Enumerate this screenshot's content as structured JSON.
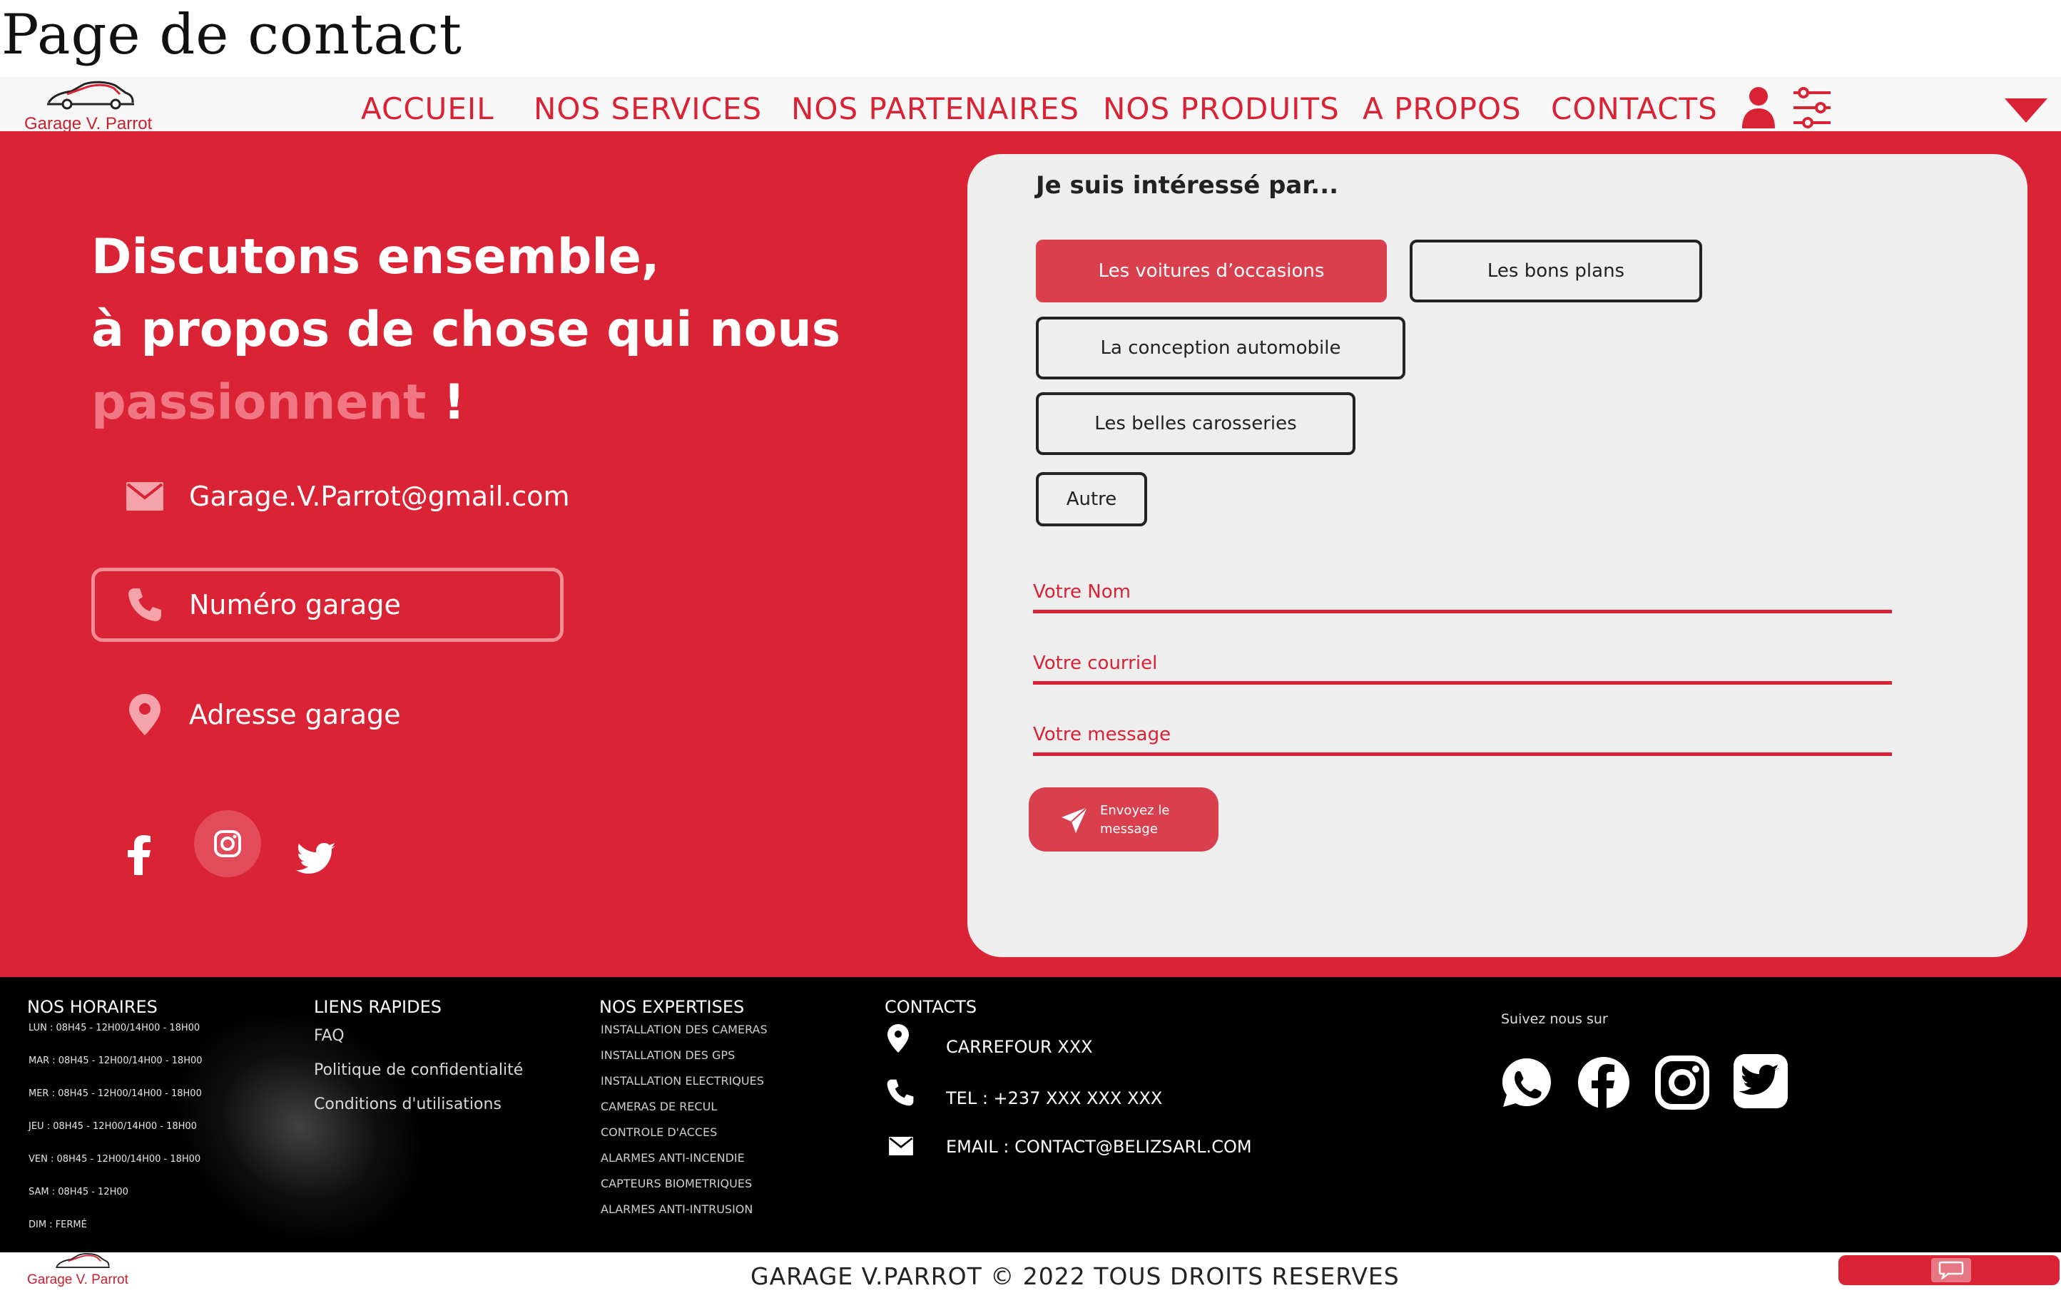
{
  "page_title": "Page de contact",
  "brand": {
    "name": "Garage V. Parrot",
    "accent": "#da2334"
  },
  "nav": {
    "items": [
      "ACCUEIL",
      "NOS SERVICES",
      "NOS PARTENAIRES",
      "NOS PRODUITS",
      "A PROPOS",
      "CONTACTS"
    ],
    "icons": [
      "user-icon",
      "settings-sliders-icon",
      "dropdown-triangle-icon"
    ]
  },
  "hero": {
    "line1": "Discutons ensemble,",
    "line2": "à propos de chose qui nous",
    "line3_accent": "passionnent",
    "line3_end": " !",
    "email": "Garage.V.Parrot@gmail.com",
    "phone": "Numéro garage",
    "address": "Adresse garage",
    "socials": [
      "facebook-icon",
      "instagram-icon",
      "twitter-icon"
    ]
  },
  "form": {
    "title": "Je suis intéressé par...",
    "chips": [
      "Les voitures d’occasions",
      "Les bons plans",
      "La conception automobile",
      "Les belles carosseries",
      "Autre"
    ],
    "active_chip": "Les voitures d’occasions",
    "name_label": "Votre Nom",
    "email_label": "Votre courriel",
    "message_label": "Votre message",
    "send_line1": "Envoyez le",
    "send_line2": "message"
  },
  "footer": {
    "hours_title": "NOS HORAIRES",
    "hours": [
      "LUN  : 08H45 - 12H00/14H00 - 18H00",
      "MAR : 08H45 - 12H00/14H00 - 18H00",
      "MER : 08H45 - 12H00/14H00 - 18H00",
      "JEU  : 08H45 - 12H00/14H00 - 18H00",
      "VEN  : 08H45 - 12H00/14H00 - 18H00",
      "SAM : 08H45 - 12H00",
      "DIM  : FERMÉ"
    ],
    "links_title": "LIENS RAPIDES",
    "links": [
      "FAQ",
      "Politique de confidentialité",
      "Conditions d'utilisations"
    ],
    "expertise_title": "NOS EXPERTISES",
    "expertises": [
      "INSTALLATION DES CAMERAS",
      "INSTALLATION DES GPS",
      "INSTALLATION ELECTRIQUES",
      "CAMERAS DE RECUL",
      "CONTROLE D'ACCES",
      "ALARMES ANTI-INCENDIE",
      "CAPTEURS BIOMETRIQUES",
      "ALARMES ANTI-INTRUSION"
    ],
    "contacts_title": "CONTACTS",
    "address": "CARREFOUR XXX",
    "tel": "TEL : +237 XXX XXX XXX",
    "email": "EMAIL : CONTACT@BELIZSARL.COM",
    "follow": "Suivez nous sur",
    "socials": [
      "whatsapp-icon",
      "facebook-icon",
      "instagram-icon",
      "twitter-icon"
    ]
  },
  "bottom": {
    "brand": "Garage V. Parrot",
    "copyright": "GARAGE V.PARROT © 2022 TOUS DROITS RESERVES"
  }
}
